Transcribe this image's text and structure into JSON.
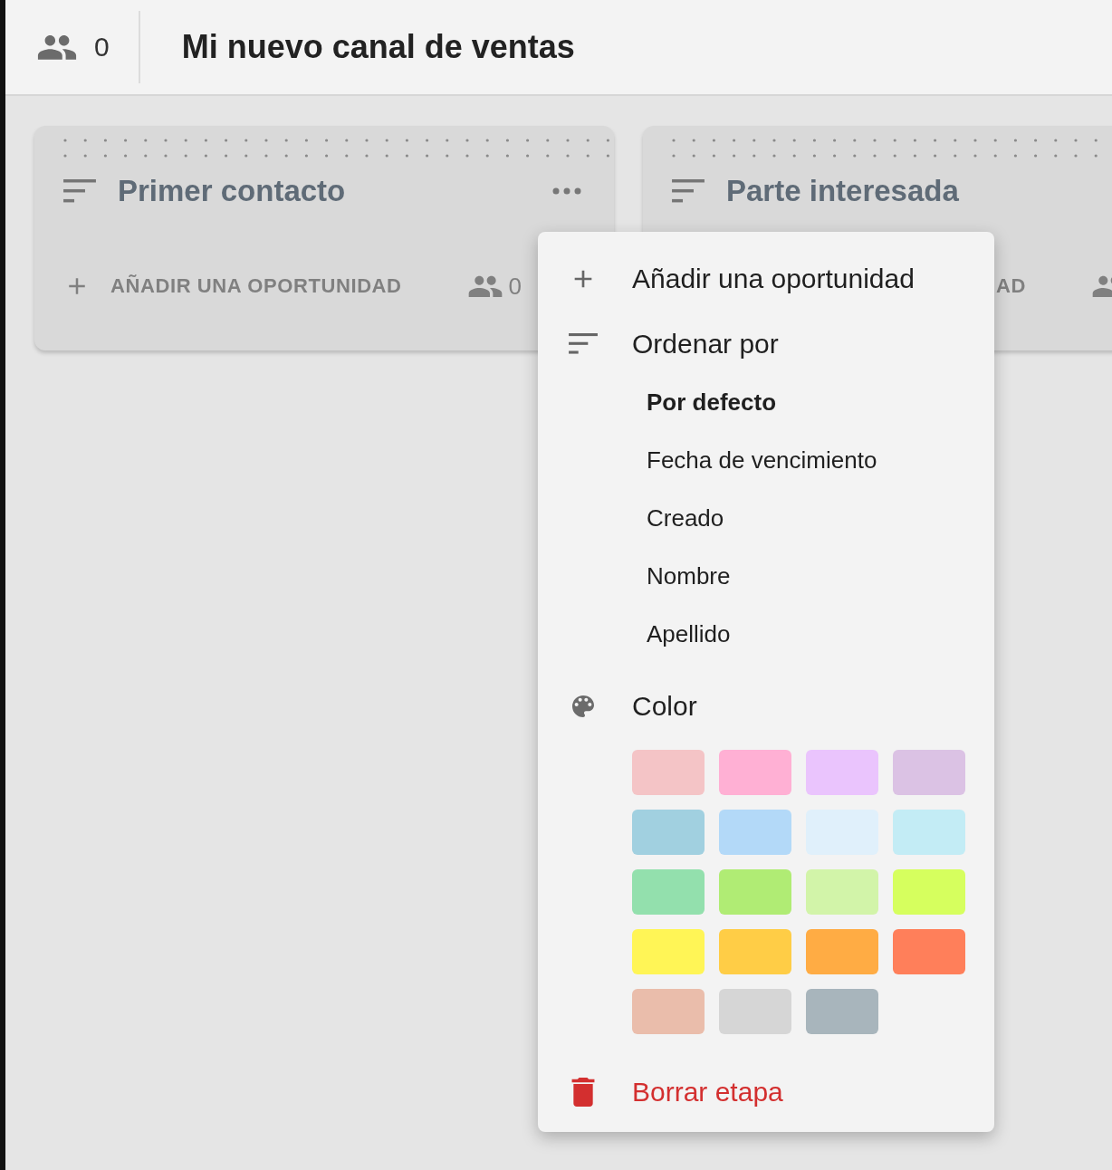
{
  "header": {
    "member_count": "0",
    "title": "Mi nuevo canal de ventas"
  },
  "columns": [
    {
      "title": "Primer contacto",
      "add_button": {
        "kind": "full",
        "label": "AÑADIR UNA OPORTUNIDAD"
      },
      "member_count": "0"
    },
    {
      "title": "Parte interesada",
      "add_button": {
        "kind": "partial",
        "label": "AD"
      }
    }
  ],
  "menu": {
    "add_item": "Añadir una oportunidad",
    "sort_heading": "Ordenar por",
    "sort_options": [
      {
        "label": "Por defecto",
        "selected": true
      },
      {
        "label": "Fecha de vencimiento",
        "selected": false
      },
      {
        "label": "Creado",
        "selected": false
      },
      {
        "label": "Nombre",
        "selected": false
      },
      {
        "label": "Apellido",
        "selected": false
      }
    ],
    "color_heading": "Color",
    "swatches": [
      {
        "color": "#f4c4c6"
      },
      {
        "color": "#ffb0d4"
      },
      {
        "color": "#eac4fd"
      },
      {
        "color": "#dbc2e4"
      },
      {
        "color": "#a1d0e0"
      },
      {
        "color": "#b3d9f8"
      },
      {
        "color": "#e0f0fb"
      },
      {
        "color": "#c3ecf5"
      },
      {
        "color": "#93e0ad"
      },
      {
        "color": "#b0ec74"
      },
      {
        "color": "#d2f4a9"
      },
      {
        "color": "#d6ff5e"
      },
      {
        "color": "#fff556"
      },
      {
        "color": "#ffcd46"
      },
      {
        "color": "#ffac44"
      },
      {
        "color": "#ff7f5a"
      },
      {
        "color": "#eabdab"
      },
      {
        "color": "#d6d6d6"
      },
      {
        "color": "#a8b5bc"
      }
    ],
    "delete_item": "Borrar etapa"
  }
}
